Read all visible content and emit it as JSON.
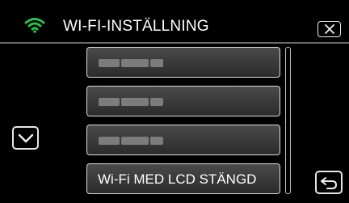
{
  "header": {
    "title": "WI-FI-INSTÄLLNING",
    "wifi_icon": "wifi-icon",
    "close_icon": "close-icon",
    "accent_color": "#29c24a"
  },
  "list": {
    "items": [
      {
        "label": "",
        "masked": true
      },
      {
        "label": "",
        "masked": true
      },
      {
        "label": "",
        "masked": true
      },
      {
        "label": "Wi-Fi MED LCD STÄNGD",
        "masked": false
      }
    ]
  },
  "controls": {
    "scroll_down_icon": "chevron-down-icon",
    "back_icon": "return-arrow-icon"
  }
}
